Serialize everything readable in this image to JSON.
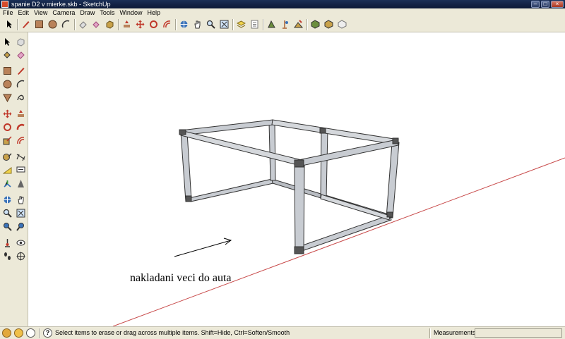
{
  "window": {
    "title": "spanie D2 v mierke.skb - SketchUp"
  },
  "menu": [
    "File",
    "Edit",
    "View",
    "Camera",
    "Draw",
    "Tools",
    "Window",
    "Help"
  ],
  "toolbar_icons": [
    "select-icon",
    "pencil-icon",
    "rectangle-icon",
    "circle-icon",
    "arc-icon",
    "eraser-icon",
    "paint-bucket-icon",
    "component-icon",
    "push-pull-icon",
    "move-icon",
    "rotate-icon",
    "offset-icon",
    "orbit-icon",
    "pan-icon",
    "zoom-icon",
    "zoom-extents-icon",
    "layers-icon",
    "outliner-icon",
    "walk-icon",
    "look-around-icon",
    "position-camera-icon",
    "section-plane-icon",
    "display-section-icon",
    "styles-icon"
  ],
  "left_tool_icons": [
    "select-icon",
    "component-icon",
    "paint-bucket-icon",
    "eraser-icon",
    "rectangle-icon",
    "line-icon",
    "circle-icon",
    "arc-icon",
    "polygon-icon",
    "freehand-icon",
    "move-icon",
    "push-pull-icon",
    "rotate-icon",
    "follow-me-icon",
    "scale-icon",
    "offset-icon",
    "tape-measure-icon",
    "dimension-icon",
    "protractor-icon",
    "text-icon",
    "axes-icon",
    "3d-text-icon",
    "orbit-icon",
    "pan-icon",
    "zoom-icon",
    "zoom-window-icon",
    "previous-view-icon",
    "zoom-extents-icon",
    "position-camera-icon",
    "look-around-icon",
    "walk-icon",
    "section-plane-icon"
  ],
  "annotation": {
    "text": "nakladani veci do auta"
  },
  "status": {
    "hint": "Select items to erase or drag across multiple items. Shift=Hide, Ctrl=Soften/Smooth",
    "measurements_label": "Measurements",
    "measurements_value": ""
  }
}
